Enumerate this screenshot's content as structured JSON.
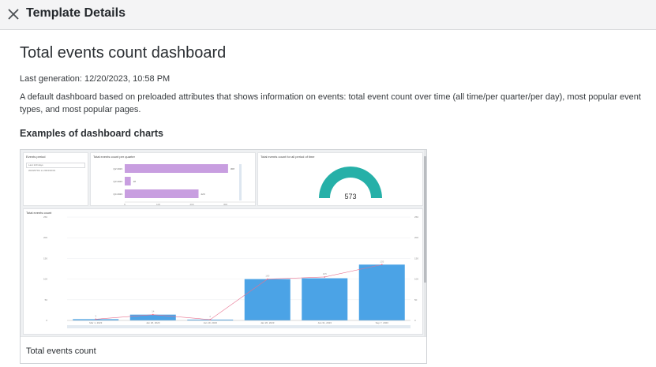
{
  "header": {
    "title": "Template Details",
    "close_icon": "close-icon"
  },
  "main": {
    "title": "Total events count dashboard",
    "last_generation": "Last generation: 12/20/2023, 10:58 PM",
    "description": "A default dashboard based on preloaded attributes that shows information on events: total event count over time (all time/per quarter/per day), most popular event types, and most popular pages.",
    "examples_heading": "Examples of dashboard charts"
  },
  "preview": {
    "caption": "Total events count",
    "filter_panel": {
      "title": "Events period",
      "value": "Last 120 days",
      "sub": "2023/07/01 to 2023/10/31"
    },
    "bar_panel": {
      "title": "Total events count per quarter",
      "chart_data": {
        "type": "bar",
        "orientation": "horizontal",
        "categories": [
          "Q2 2023",
          "Q3 2023",
          "Q4 2023"
        ],
        "values": [
          308,
          18,
          220
        ],
        "xlim": [
          0,
          400
        ],
        "ticks": [
          "0",
          "100",
          "200",
          "300",
          "400"
        ],
        "color": "#c89ee0"
      }
    },
    "gauge_panel": {
      "title": "Total events count for all period of time",
      "chart_data": {
        "type": "gauge",
        "value": 573,
        "label": "573",
        "color": "#26b0a8"
      }
    },
    "main_chart": {
      "title": "Total events count",
      "chart_data": {
        "type": "bar",
        "categories": [
          "Mar 1, 2023",
          "Jan 18, 2023",
          "Jan 19, 2023",
          "Jan 26, 2023",
          "Jan 31, 2023",
          "Sep 7, 2023"
        ],
        "bar_values": [
          3,
          14,
          2,
          100,
          102,
          135
        ],
        "line_values": [
          3,
          14,
          2,
          100,
          105,
          135
        ],
        "ylim": [
          0,
          250
        ],
        "yticks": [
          "0",
          "50",
          "100",
          "150",
          "200",
          "250"
        ],
        "bar_color": "#4ba3e6",
        "line_color": "#e8718f"
      }
    }
  }
}
